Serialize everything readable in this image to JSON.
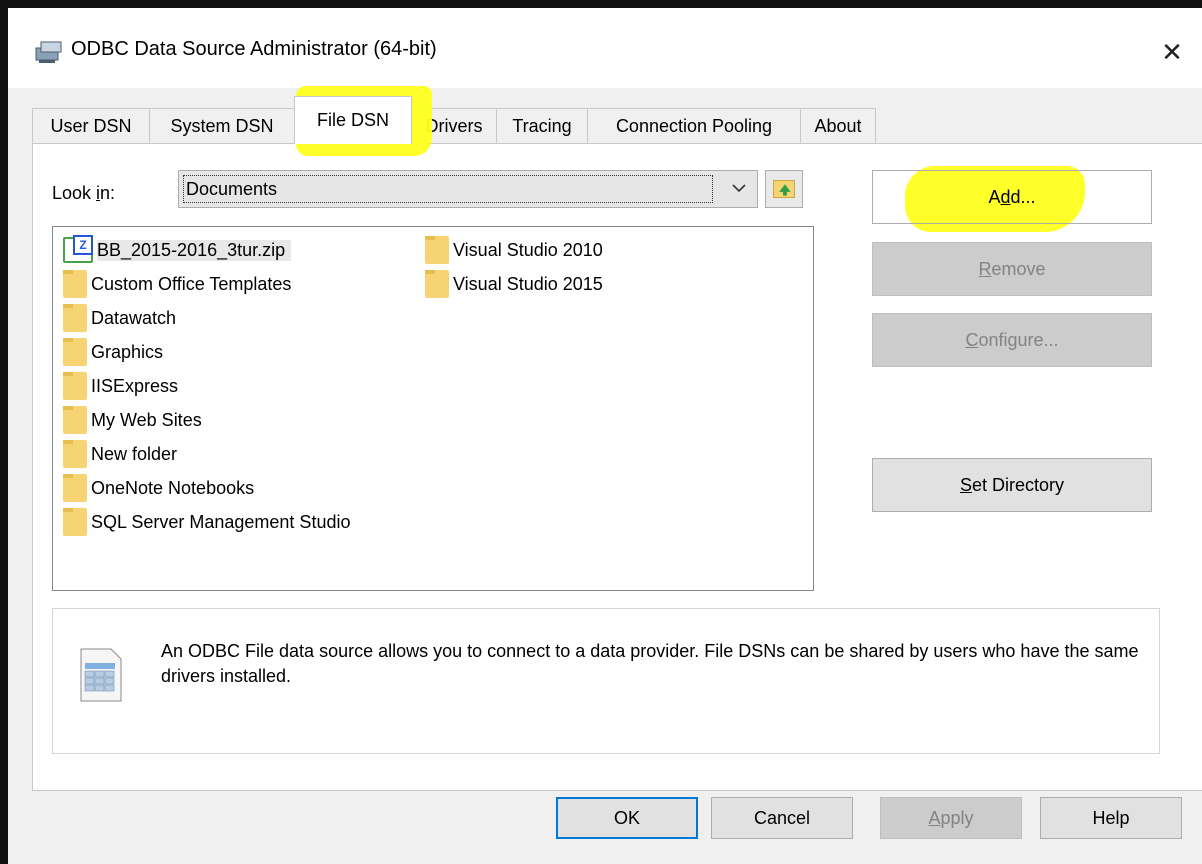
{
  "window": {
    "title": "ODBC Data Source Administrator (64-bit)",
    "close_glyph": "✕"
  },
  "tabs": [
    {
      "label": "User DSN"
    },
    {
      "label": "System DSN"
    },
    {
      "label": "File DSN",
      "active": true
    },
    {
      "label": "Drivers"
    },
    {
      "label": "Tracing"
    },
    {
      "label": "Connection Pooling"
    },
    {
      "label": "About"
    }
  ],
  "look_in": {
    "label_pre": "Look ",
    "label_accel": "i",
    "label_post": "n:",
    "value": "Documents"
  },
  "file_list": {
    "items": [
      {
        "name": "BB_2015-2016_3tur.zip",
        "type": "zip",
        "zip_badge": "Z",
        "selected": true
      },
      {
        "name": "Custom Office Templates",
        "type": "folder"
      },
      {
        "name": "Datawatch",
        "type": "folder"
      },
      {
        "name": "Graphics",
        "type": "folder"
      },
      {
        "name": "IISExpress",
        "type": "folder"
      },
      {
        "name": "My Web Sites",
        "type": "folder"
      },
      {
        "name": "New folder",
        "type": "folder"
      },
      {
        "name": "OneNote Notebooks",
        "type": "folder"
      },
      {
        "name": "SQL Server Management Studio",
        "type": "folder"
      },
      {
        "name": "Visual Studio 2010",
        "type": "folder"
      },
      {
        "name": "Visual Studio 2015",
        "type": "folder"
      }
    ]
  },
  "side_buttons": {
    "add": {
      "pre": "A",
      "accel": "d",
      "post": "d..."
    },
    "remove": {
      "pre": "",
      "accel": "R",
      "post": "emove"
    },
    "configure": {
      "pre": "",
      "accel": "C",
      "post": "onfigure..."
    },
    "set_directory": {
      "pre": "",
      "accel": "S",
      "post": "et Directory"
    }
  },
  "info": {
    "text": "An ODBC File data source allows you to connect to a data provider.  File DSNs can be shared by users who have the same drivers installed."
  },
  "bottom_buttons": {
    "ok": "OK",
    "cancel": "Cancel",
    "apply": {
      "pre": "",
      "accel": "A",
      "post": "pply"
    },
    "help": "Help"
  },
  "colors": {
    "highlight": "#ffff1e",
    "default_button_border": "#0078d7"
  }
}
